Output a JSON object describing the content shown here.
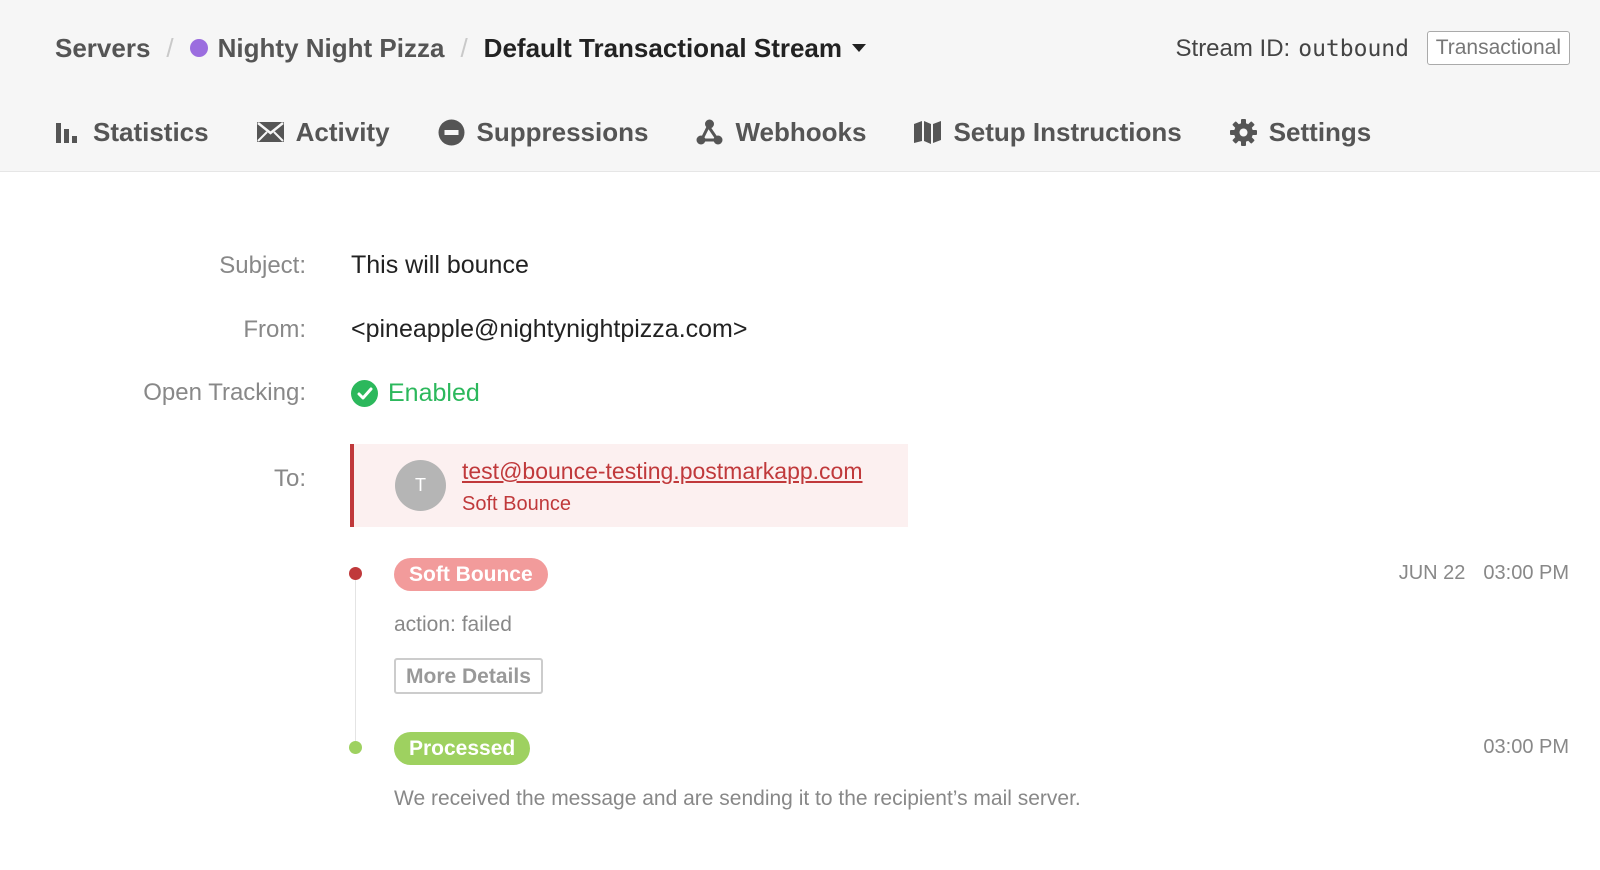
{
  "breadcrumb": {
    "servers": "Servers",
    "separator": "/",
    "server_name": "Nighty Night Pizza",
    "server_color": "#9b6ddf",
    "stream_name": "Default Transactional Stream"
  },
  "stream": {
    "id_label": "Stream ID:",
    "id_value": "outbound",
    "type": "Transactional"
  },
  "tabs": [
    {
      "label": "Statistics",
      "icon": "bar-chart-icon"
    },
    {
      "label": "Activity",
      "icon": "envelope-icon"
    },
    {
      "label": "Suppressions",
      "icon": "minus-circle-icon"
    },
    {
      "label": "Webhooks",
      "icon": "webhook-icon"
    },
    {
      "label": "Setup Instructions",
      "icon": "map-icon"
    },
    {
      "label": "Settings",
      "icon": "gear-icon"
    }
  ],
  "message": {
    "subject_label": "Subject:",
    "subject": "This will bounce",
    "from_label": "From:",
    "from": "<pineapple@nightynightpizza.com>",
    "tracking_label": "Open Tracking:",
    "tracking_value": "Enabled",
    "to_label": "To:",
    "recipient": {
      "initial": "T",
      "email": "test@bounce-testing.postmarkapp.com",
      "status": "Soft Bounce"
    }
  },
  "events": [
    {
      "badge": "Soft Bounce",
      "date": "JUN 22",
      "time": "03:00 PM",
      "detail": "action: failed",
      "button": "More Details",
      "color": "#f29b9b",
      "dot_color": "#c0393b"
    },
    {
      "badge": "Processed",
      "date": "",
      "time": "03:00 PM",
      "detail": "We received the message and are sending it to the recipient’s mail server.",
      "color": "#9ed160",
      "dot_color": "#9ed160"
    }
  ],
  "colors": {
    "success": "#2cb85c",
    "bounce": "#c0393b"
  }
}
